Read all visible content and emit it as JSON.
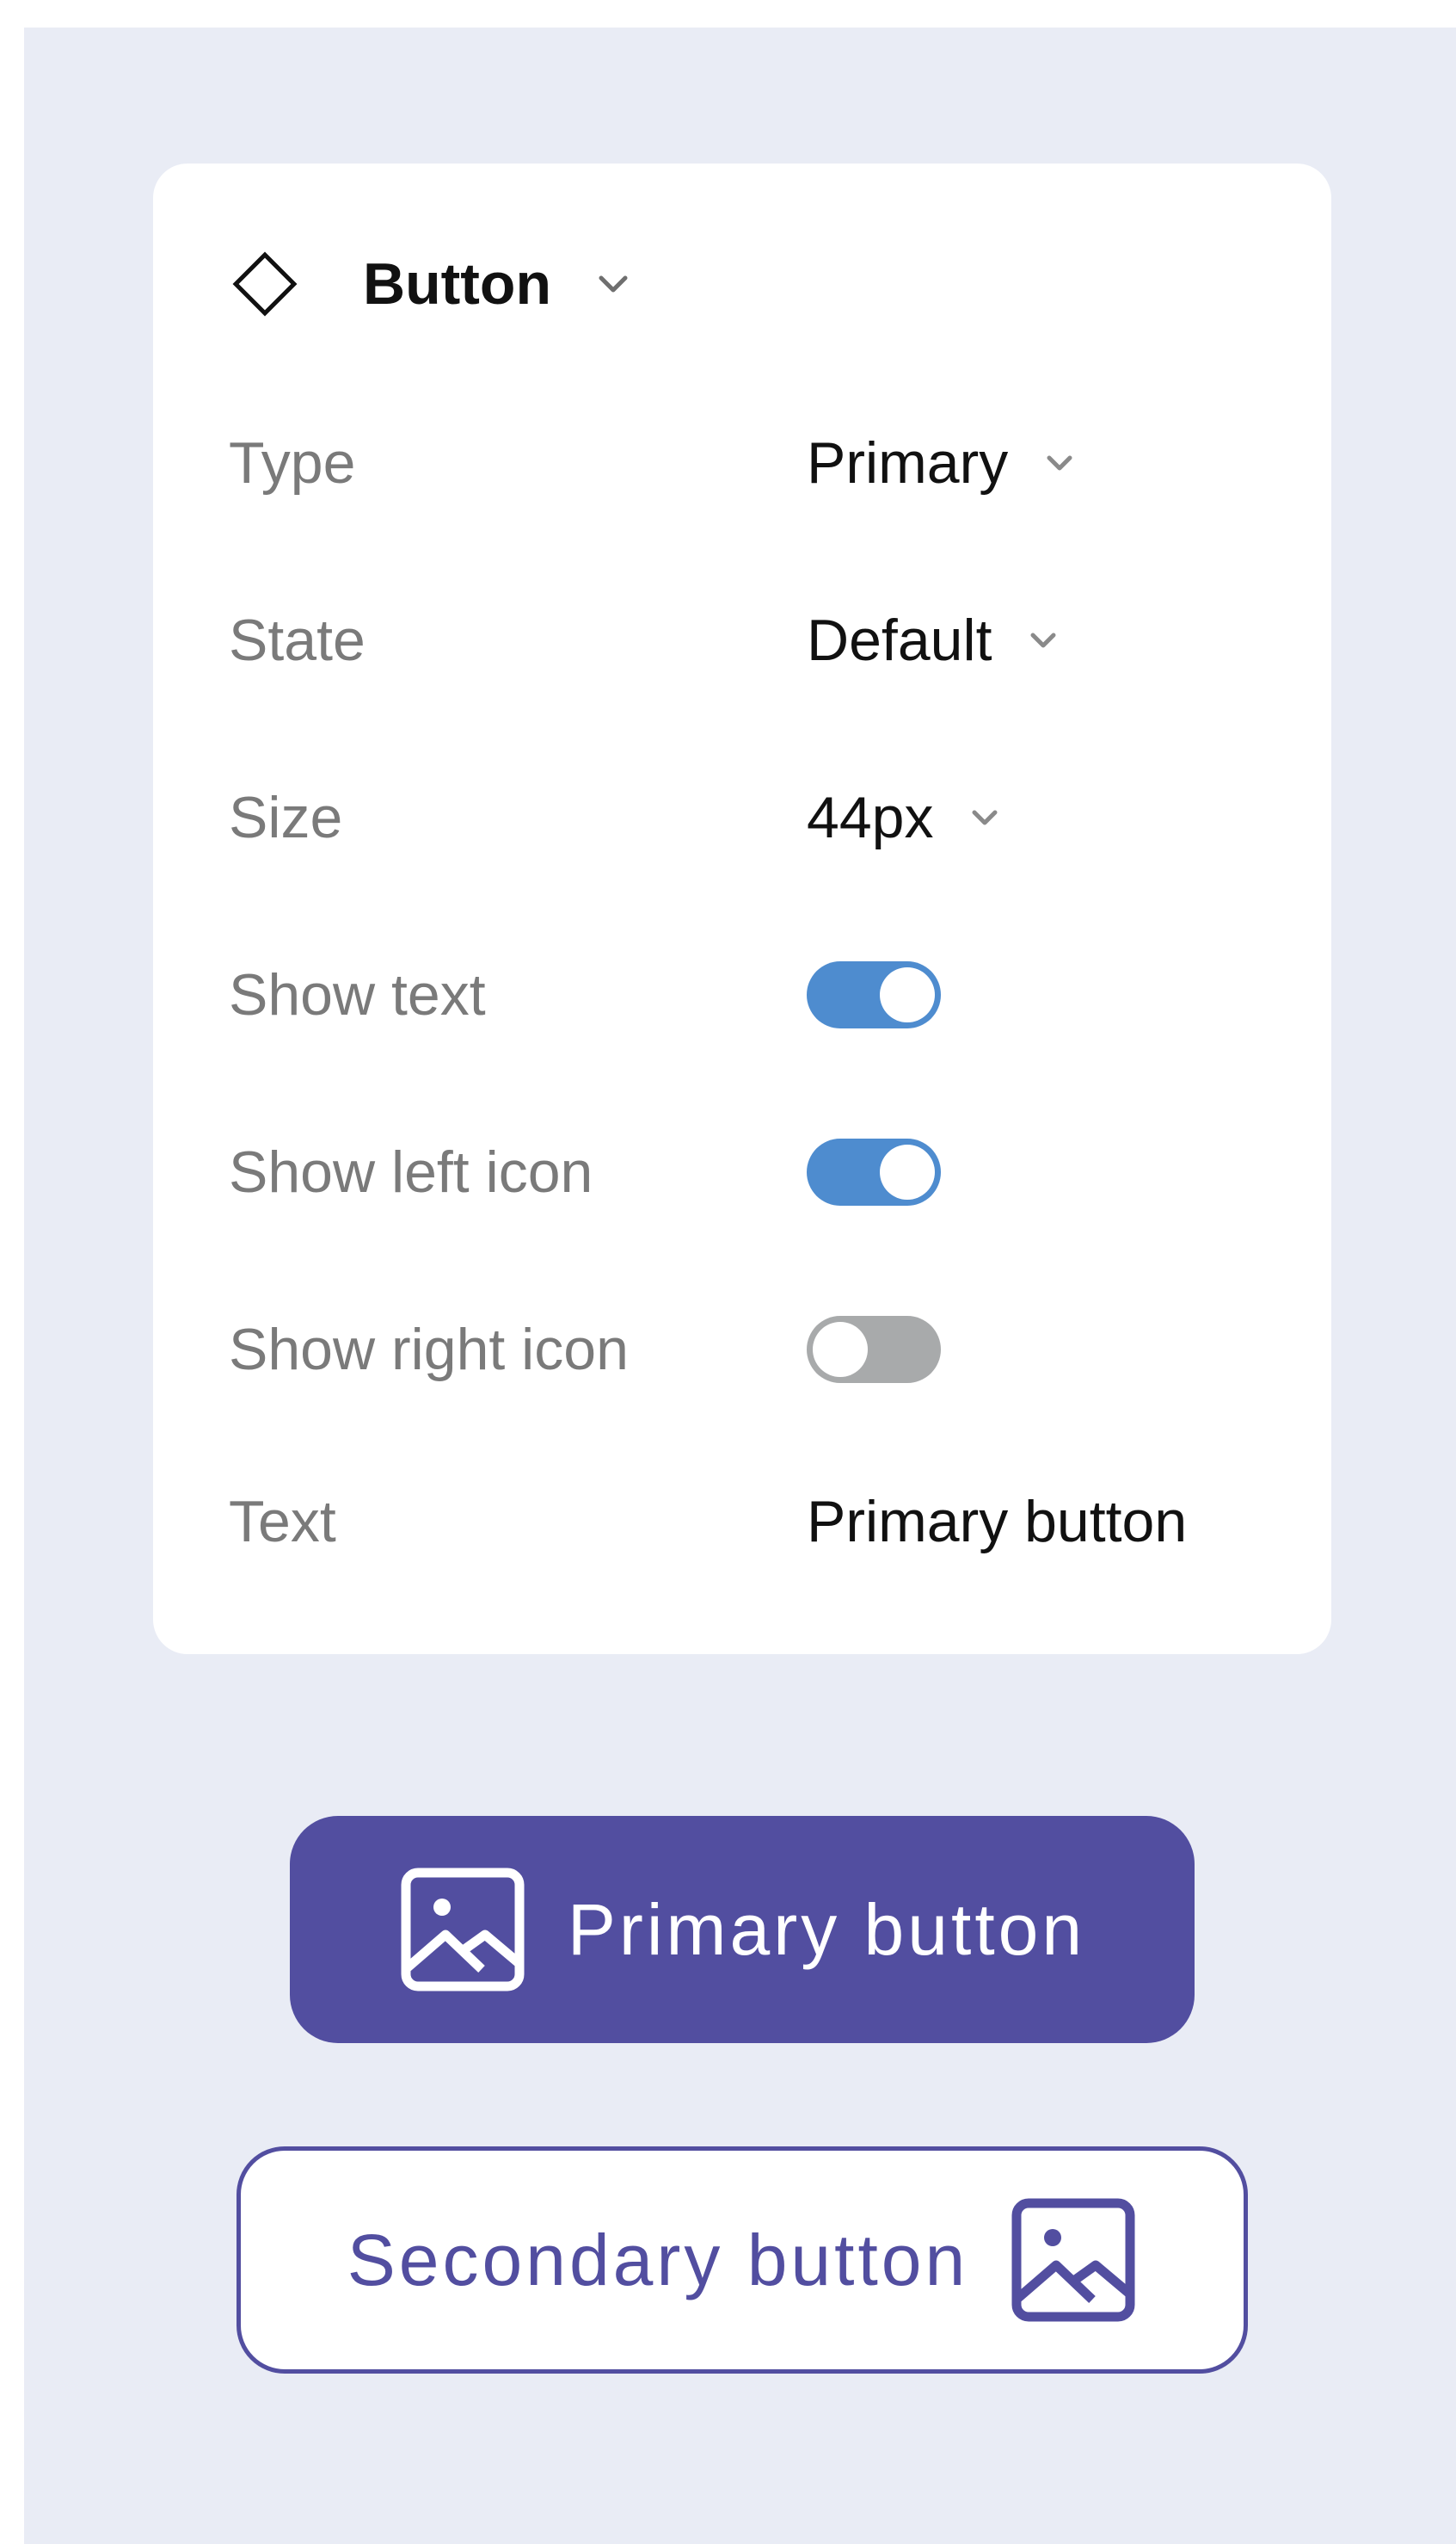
{
  "panel": {
    "title": "Button",
    "header_icon": "diamond-icon",
    "rows": [
      {
        "label": "Type",
        "value": "Primary",
        "control": "dropdown"
      },
      {
        "label": "State",
        "value": "Default",
        "control": "dropdown"
      },
      {
        "label": "Size",
        "value": "44px",
        "control": "dropdown"
      },
      {
        "label": "Show text",
        "control": "toggle",
        "on": true
      },
      {
        "label": "Show left icon",
        "control": "toggle",
        "on": true
      },
      {
        "label": "Show right icon",
        "control": "toggle",
        "on": false
      },
      {
        "label": "Text",
        "value": "Primary button",
        "control": "text"
      }
    ]
  },
  "preview": {
    "primary_button": {
      "label": "Primary button",
      "icon": "image-icon",
      "icon_position": "left"
    },
    "secondary_button": {
      "label": "Secondary button",
      "icon": "image-icon",
      "icon_position": "right"
    }
  },
  "colors": {
    "background": "#e9ecf5",
    "panel": "#ffffff",
    "accent": "#524ea0",
    "toggle_on": "#4e8ccf",
    "toggle_off": "#a8aaab",
    "label_text": "#7a7a7a",
    "value_text": "#111111"
  }
}
